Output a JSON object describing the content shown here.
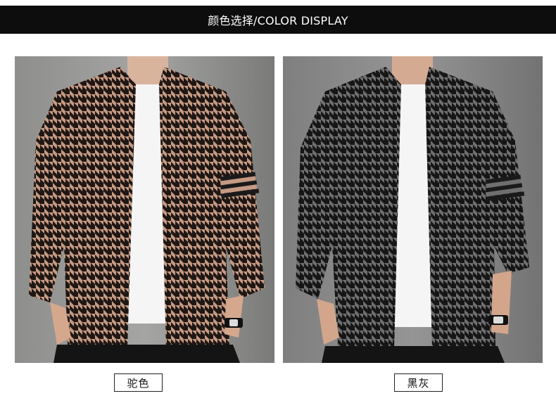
{
  "header": {
    "title": "颜色选择/COLOR DISPLAY"
  },
  "products": [
    {
      "color_name": "驼色",
      "base_color": "#c59a83",
      "dark_color": "#1f1714",
      "bg_color": "#9b9b99"
    },
    {
      "color_name": "黑灰",
      "base_color": "#6f6f70",
      "dark_color": "#161616",
      "bg_color": "#8b8b8b"
    }
  ]
}
